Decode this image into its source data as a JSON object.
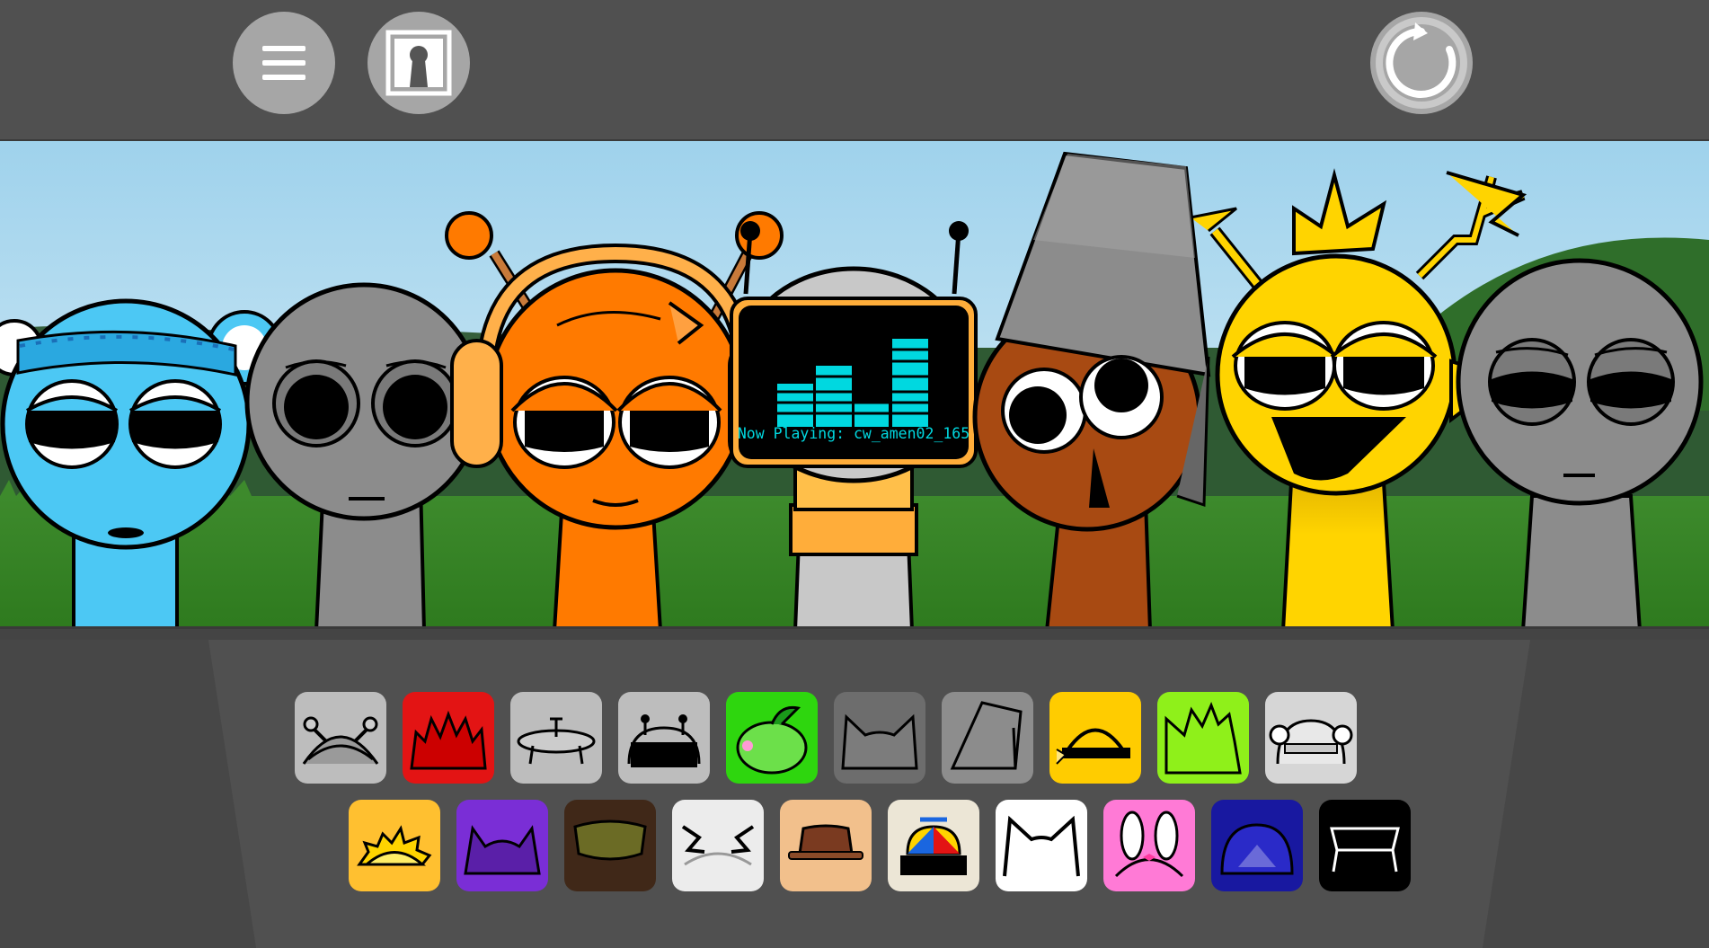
{
  "topbar": {
    "menu_button": {
      "icon": "hamburger-menu-icon"
    },
    "portrait_button": {
      "icon": "keyhole-portrait-icon"
    },
    "reset_button": {
      "icon": "restart-icon"
    }
  },
  "stage": {
    "characters": [
      {
        "slot": 1,
        "state": "active",
        "color": "#4cc8f4",
        "accessory": "headband with bear ears"
      },
      {
        "slot": 2,
        "state": "empty",
        "color": "#8c8c8c"
      },
      {
        "slot": 3,
        "state": "active",
        "color": "#ff7a00",
        "accessory": "headphones and antennae"
      },
      {
        "slot": 4,
        "state": "active",
        "color": "#c8c8c8",
        "accessory": "tv screen"
      },
      {
        "slot": 5,
        "state": "active",
        "color": "#a84a12",
        "accessory": "bucket"
      },
      {
        "slot": 6,
        "state": "active",
        "color": "#ffd400",
        "accessory": "spiky hair and lightning"
      },
      {
        "slot": 7,
        "state": "empty",
        "color": "#8c8c8c"
      }
    ],
    "tv_screen": {
      "text": "Now Playing: cw_amen02_165"
    }
  },
  "tray": {
    "row1": [
      {
        "name": "antenna-loops-sound",
        "bg": "#bdbdbd"
      },
      {
        "name": "red-spiky-sound",
        "bg": "#e31414"
      },
      {
        "name": "ufo-dish-sound",
        "bg": "#bdbdbd"
      },
      {
        "name": "tv-antenna-sound",
        "bg": "#bdbdbd"
      },
      {
        "name": "green-melon-sound",
        "bg": "#2ed60e"
      },
      {
        "name": "cat-ears-gray-sound",
        "bg": "#6d6d6d"
      },
      {
        "name": "bucket-sound",
        "bg": "#8d8d8d"
      },
      {
        "name": "yellow-headphones-sound",
        "bg": "#ffcc00"
      },
      {
        "name": "lime-spiky-sound",
        "bg": "#8ff01a"
      },
      {
        "name": "headband-bear-sound",
        "bg": "#d6d6d6"
      }
    ],
    "row2": [
      {
        "name": "sun-crown-sound",
        "bg": "#ffc030"
      },
      {
        "name": "purple-horns-sound",
        "bg": "#7a2ed6"
      },
      {
        "name": "olive-hair-sound",
        "bg": "#402818"
      },
      {
        "name": "white-lightning-sound",
        "bg": "#ececec"
      },
      {
        "name": "brown-hat-sound",
        "bg": "#f2c08c"
      },
      {
        "name": "propeller-cap-sound",
        "bg": "#ece6d6"
      },
      {
        "name": "white-cat-sound",
        "bg": "#ffffff"
      },
      {
        "name": "pink-bunny-sound",
        "bg": "#ff7ad6"
      },
      {
        "name": "blue-dome-sound",
        "bg": "#1818a0"
      },
      {
        "name": "black-bench-sound",
        "bg": "#000000"
      }
    ]
  }
}
